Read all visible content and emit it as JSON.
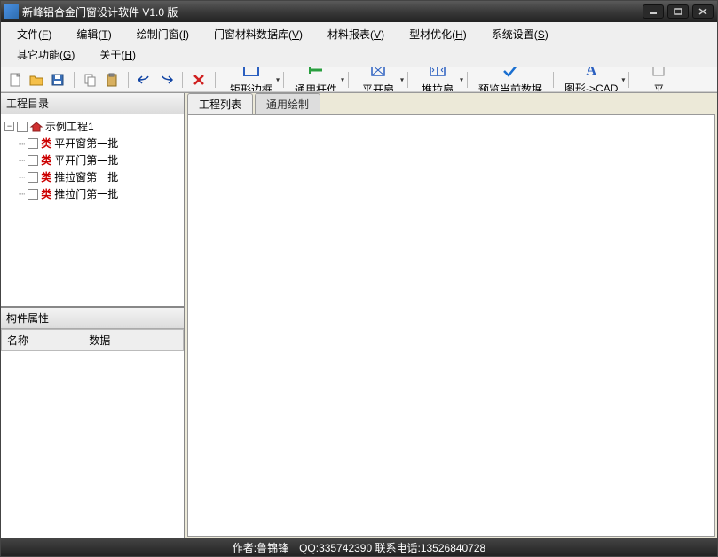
{
  "title": "新峰铝合金门窗设计软件 V1.0 版",
  "menu": {
    "row1": [
      {
        "label": "文件",
        "key": "F"
      },
      {
        "label": "编辑",
        "key": "T"
      },
      {
        "label": "绘制门窗",
        "key": "I"
      },
      {
        "label": "门窗材料数据库",
        "key": "V"
      },
      {
        "label": "材料报表",
        "key": "V"
      },
      {
        "label": "型材优化",
        "key": "H"
      },
      {
        "label": "系统设置",
        "key": "S"
      }
    ],
    "row2": [
      {
        "label": "其它功能",
        "key": "G"
      },
      {
        "label": "关于",
        "key": "H"
      }
    ]
  },
  "toolbar_big": [
    {
      "name": "rect-frame",
      "label": "矩形边框",
      "drop": true,
      "icon": "rect"
    },
    {
      "name": "general-bar",
      "label": "通用杆件",
      "drop": true,
      "icon": "bar"
    },
    {
      "name": "casement",
      "label": "平开扇",
      "drop": true,
      "icon": "casement"
    },
    {
      "name": "sliding",
      "label": "推拉扇",
      "drop": true,
      "icon": "sliding"
    },
    {
      "name": "preview",
      "label": "预览当前数据",
      "drop": false,
      "icon": "check"
    },
    {
      "name": "to-cad",
      "label": "图形->CAD",
      "drop": true,
      "icon": "A"
    },
    {
      "name": "more",
      "label": "平",
      "drop": false,
      "icon": "misc"
    }
  ],
  "left": {
    "project_dir_title": "工程目录",
    "root": "示例工程1",
    "children": [
      {
        "tag": "类",
        "label": "平开窗第一批"
      },
      {
        "tag": "类",
        "label": "平开门第一批"
      },
      {
        "tag": "类",
        "label": "推拉窗第一批"
      },
      {
        "tag": "类",
        "label": "推拉门第一批"
      }
    ],
    "props_title": "构件属性",
    "col_name": "名称",
    "col_data": "数据"
  },
  "tabs": [
    {
      "label": "工程列表",
      "active": true
    },
    {
      "label": "通用绘制",
      "active": false
    }
  ],
  "status": "作者:鲁锦锋　QQ:335742390 联系电话:13526840728"
}
